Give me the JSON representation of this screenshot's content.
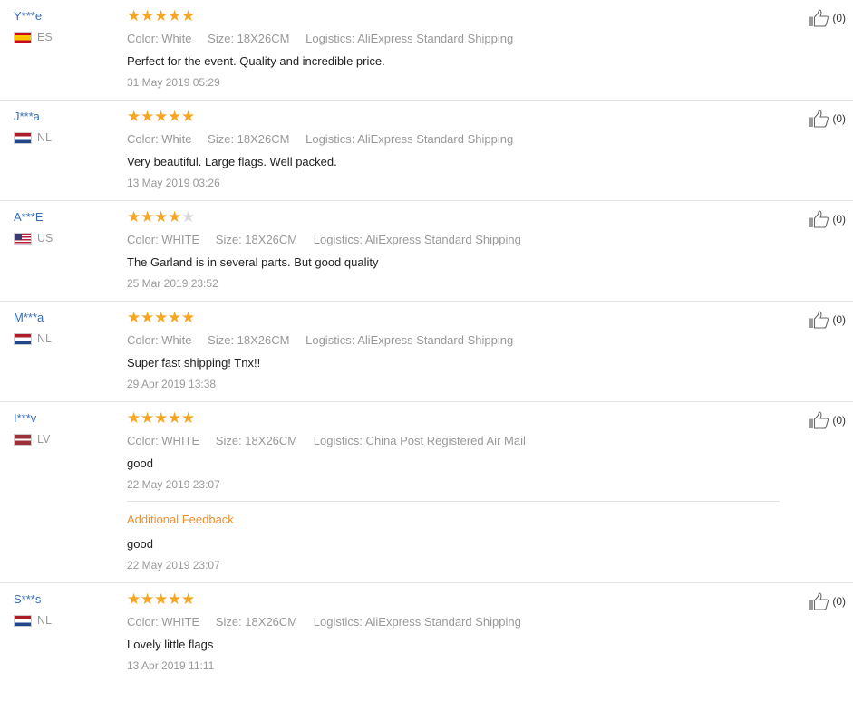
{
  "reviews": [
    {
      "user": "Y***e",
      "country": "ES",
      "rating": 5,
      "color": "Color: White",
      "size": "Size: 18X26CM",
      "logistics": "Logistics: AliExpress Standard Shipping",
      "text": "Perfect for the event. Quality and incredible price.",
      "date": "31 May 2019 05:29",
      "likes": "(0)"
    },
    {
      "user": "J***a",
      "country": "NL",
      "rating": 5,
      "color": "Color: White",
      "size": "Size: 18X26CM",
      "logistics": "Logistics: AliExpress Standard Shipping",
      "text": "Very beautiful. Large flags. Well packed.",
      "date": "13 May 2019 03:26",
      "likes": "(0)"
    },
    {
      "user": "A***E",
      "country": "US",
      "rating": 4,
      "color": "Color: WHITE",
      "size": "Size: 18X26CM",
      "logistics": "Logistics: AliExpress Standard Shipping",
      "text": "The Garland is in several parts. But good quality",
      "date": "25 Mar 2019 23:52",
      "likes": "(0)"
    },
    {
      "user": "M***a",
      "country": "NL",
      "rating": 5,
      "color": "Color: White",
      "size": "Size: 18X26CM",
      "logistics": "Logistics: AliExpress Standard Shipping",
      "text": "Super fast shipping! Tnx!!",
      "date": "29 Apr 2019 13:38",
      "likes": "(0)"
    },
    {
      "user": "I***v",
      "country": "LV",
      "rating": 5,
      "color": "Color: WHITE",
      "size": "Size: 18X26CM",
      "logistics": "Logistics: China Post Registered Air Mail",
      "text": "good",
      "date": "22 May 2019 23:07",
      "likes": "(0)",
      "additional": {
        "label": "Additional Feedback",
        "text": "good",
        "date": "22 May 2019 23:07"
      }
    },
    {
      "user": "S***s",
      "country": "NL",
      "rating": 5,
      "color": "Color: WHITE",
      "size": "Size: 18X26CM",
      "logistics": "Logistics: AliExpress Standard Shipping",
      "text": "Lovely little flags",
      "date": "13 Apr 2019 11:11",
      "likes": "(0)"
    }
  ],
  "colors": {
    "star": "#f5a623",
    "star_empty": "#d9d9d9",
    "user_name": "#3a6cb6",
    "additional_label": "#f0912d"
  },
  "icons": {
    "like": "thumbs-up-icon",
    "star": "star-icon"
  }
}
